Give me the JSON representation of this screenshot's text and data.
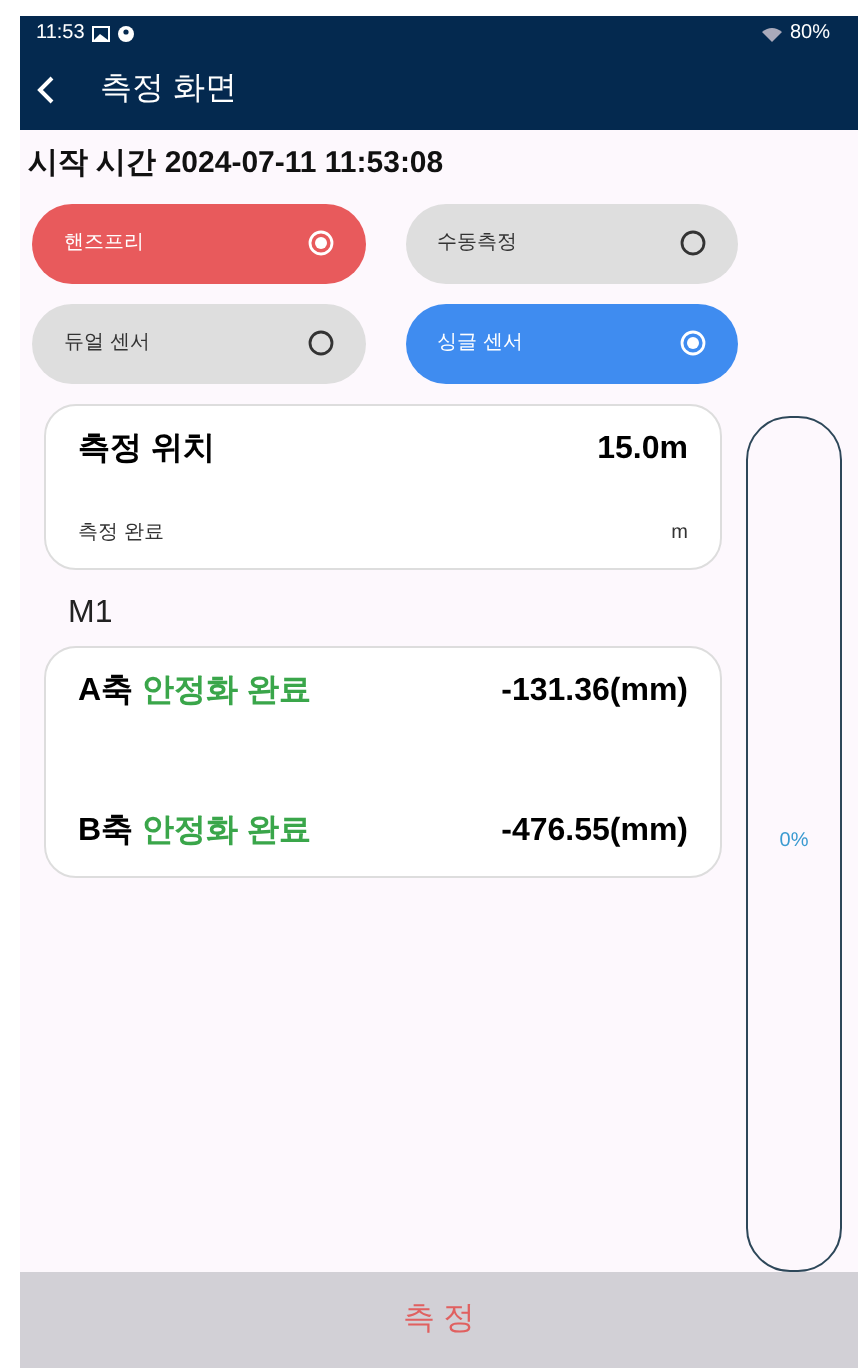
{
  "status_bar": {
    "time": "11:53",
    "battery": "80%"
  },
  "app_bar": {
    "title": "측정 화면"
  },
  "start_time": {
    "label": "시작 시간",
    "value": "2024-07-11 11:53:08"
  },
  "option_groups": [
    {
      "color": "#e85a5c",
      "options": [
        {
          "label": "핸즈프리",
          "selected": true
        },
        {
          "label": "수동측정",
          "selected": false
        }
      ]
    },
    {
      "color": "#3f8cf0",
      "options": [
        {
          "label": "듀얼 센서",
          "selected": false
        },
        {
          "label": "싱글 센서",
          "selected": true
        }
      ]
    }
  ],
  "position_card": {
    "label": "측정 위치",
    "value": "15.0m",
    "status": "측정 완료",
    "unit": "m"
  },
  "section": "M1",
  "axes": [
    {
      "axis": "A축",
      "state": "안정화 완료",
      "value": "-131.36(mm)"
    },
    {
      "axis": "B축",
      "state": "안정화 완료",
      "value": "-476.55(mm)"
    }
  ],
  "progress": {
    "level": 0,
    "reading": "0%"
  },
  "measure_button": "측 정"
}
